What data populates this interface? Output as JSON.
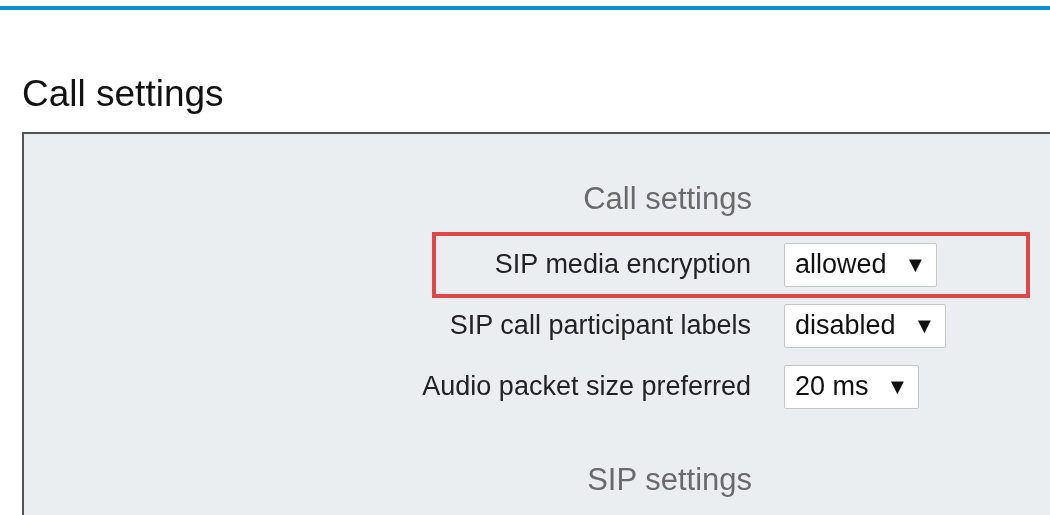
{
  "page_title": "Call settings",
  "sections": [
    {
      "heading": "Call settings",
      "settings": [
        {
          "label": "SIP media encryption",
          "value": "allowed",
          "arrow": "▼",
          "highlighted": true
        },
        {
          "label": "SIP call participant labels",
          "value": "disabled",
          "arrow": "▼",
          "highlighted": false
        },
        {
          "label": "Audio packet size preferred",
          "value": "20 ms",
          "arrow": "▼",
          "highlighted": false
        }
      ]
    },
    {
      "heading": "SIP settings"
    }
  ]
}
